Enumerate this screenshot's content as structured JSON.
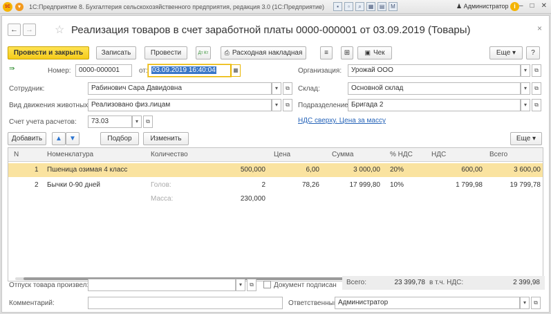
{
  "app": {
    "title": "1С:Предприятие 8. Бухгалтерия сельскохозяйственного предприятия, редакция 3.0  (1С:Предприятие)",
    "logo_text": "1С",
    "user": "Администратор",
    "window_controls": [
      "–",
      "□",
      "✕"
    ]
  },
  "document": {
    "title": "Реализация товаров в счет заработной платы 0000-000001 от 03.09.2019 (Товары)",
    "nav_back": "←",
    "nav_forward": "→"
  },
  "toolbar": {
    "post_close": "Провести и закрыть",
    "save": "Записать",
    "post": "Провести",
    "dtkt": "Дт Кт",
    "invoice": "Расходная накладная",
    "check": "Чек",
    "more": "Еще",
    "help": "?"
  },
  "header": {
    "number_label": "Номер:",
    "number_value": "0000-000001",
    "date_label": "от:",
    "date_value": "03.09.2019 16:40:04",
    "org_label": "Организация:",
    "org_value": "Урожай ООО",
    "employee_label": "Сотрудник:",
    "employee_value": "Рабинович Сара Давидовна",
    "warehouse_label": "Склад:",
    "warehouse_value": "Основной склад",
    "movement_label": "Вид движения животных:",
    "movement_value": "Реализовано физ.лицам",
    "division_label": "Подразделение:",
    "division_value": "Бригада 2",
    "account_label": "Счет учета расчетов:",
    "account_value": "73.03",
    "vat_link": "НДС сверху. Цена за массу"
  },
  "table_toolbar": {
    "add": "Добавить",
    "selection": "Подбор",
    "change": "Изменить",
    "more": "Еще"
  },
  "table": {
    "columns": [
      "N",
      "Номенклатура",
      "Количество",
      "Цена",
      "Сумма",
      "% НДС",
      "НДС",
      "Всего"
    ],
    "rows": [
      {
        "n": "1",
        "name": "Пшеница озимая 4 класс",
        "qty": "500,000",
        "price": "6,00",
        "sum": "3 000,00",
        "vat_rate": "20%",
        "vat": "600,00",
        "total": "3 600,00"
      },
      {
        "n": "2",
        "name": "Бычки 0-90 дней",
        "heads_label": "Голов:",
        "heads": "2",
        "mass_label": "Масса:",
        "mass": "230,000",
        "price": "78,26",
        "sum": "17 999,80",
        "vat_rate": "10%",
        "vat": "1 799,98",
        "total": "19 799,78"
      }
    ]
  },
  "footer": {
    "released_label": "Отпуск товара произвел:",
    "released_value": "",
    "signed_label": "Документ подписан",
    "total_label": "Всего:",
    "total_value": "23 399,78",
    "vat_label": "в т.ч. НДС:",
    "vat_value": "2 399,98",
    "comment_label": "Комментарий:",
    "comment_value": "",
    "responsible_label": "Ответственный:",
    "responsible_value": "Администратор"
  },
  "colors": {
    "primary_button": "#f5cb1a",
    "selected_row": "#fae3a0",
    "link": "#2563b8"
  }
}
